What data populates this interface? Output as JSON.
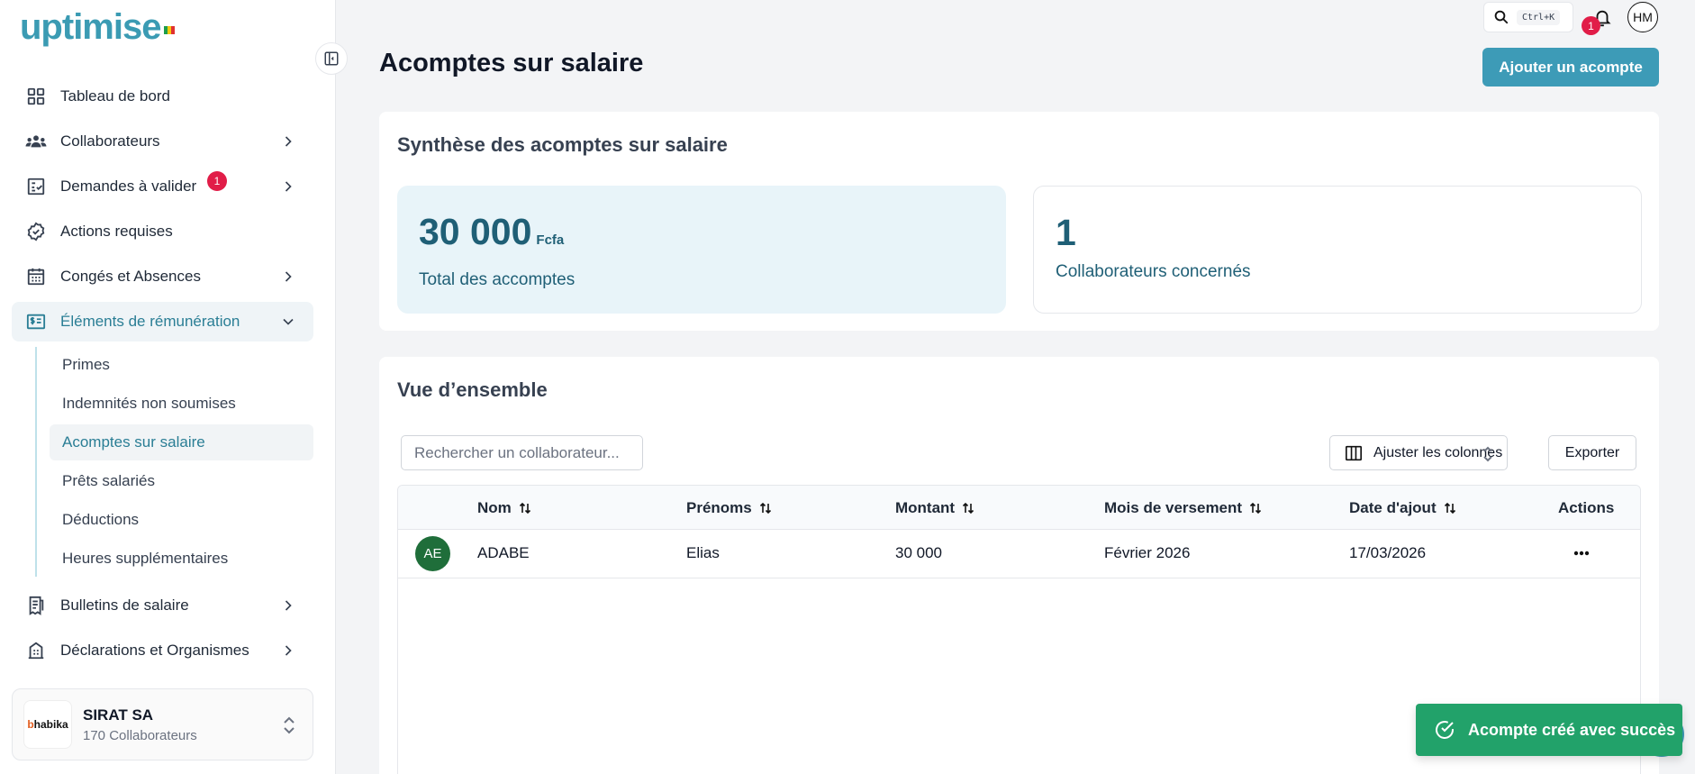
{
  "brand": {
    "logo_text": "uptimise",
    "accent": "#3d9bb7",
    "flag_colors": [
      "#1e9e4a",
      "#f6c90e",
      "#e03131"
    ]
  },
  "sidebar": {
    "items": [
      {
        "label": "Tableau de bord",
        "icon": "grid-icon"
      },
      {
        "label": "Collaborateurs",
        "icon": "users-icon",
        "has_chevron": true
      },
      {
        "label": "Demandes à valider",
        "icon": "checklist-icon",
        "has_chevron": true,
        "badge": "1"
      },
      {
        "label": "Actions requises",
        "icon": "badge-check-icon"
      },
      {
        "label": "Congés et Absences",
        "icon": "calendar-icon",
        "has_chevron": true
      },
      {
        "label": "Éléments de rémunération",
        "icon": "id-card-icon",
        "expanded": true
      }
    ],
    "submenu": [
      "Primes",
      "Indemnités non soumises",
      "Acomptes sur salaire",
      "Prêts salariés",
      "Déductions",
      "Heures supplémentaires"
    ],
    "active_sub": "Acomptes sur salaire",
    "items_after": [
      {
        "label": "Bulletins de salaire",
        "icon": "receipt-icon",
        "has_chevron": true
      },
      {
        "label": "Déclarations et Organismes",
        "icon": "building-icon",
        "has_chevron": true
      }
    ],
    "company": {
      "logo_text": "habika",
      "name": "SIRAT SA",
      "count": "170 Collaborateurs"
    }
  },
  "topbar": {
    "shortcut": "Ctrl+K",
    "notifications": "1",
    "user_initials": "HM"
  },
  "page": {
    "title": "Acomptes sur salaire",
    "add_label": "Ajouter un acompte"
  },
  "summary": {
    "title": "Synthèse des acomptes sur salaire",
    "total_value": "30 000",
    "total_unit": "Fcfa",
    "total_label": "Total des accomptes",
    "count_value": "1",
    "count_label": "Collaborateurs concernés"
  },
  "overview": {
    "title": "Vue d’ensemble",
    "search_placeholder": "Rechercher un collaborateur...",
    "columns_label": "Ajuster les colonnes",
    "export_label": "Exporter",
    "headers": [
      "Nom",
      "Prénoms",
      "Montant",
      "Mois de versement",
      "Date d'ajout",
      "Actions"
    ],
    "rows": [
      {
        "initials": "AE",
        "nom": "ADABE",
        "prenoms": "Elias",
        "montant": "30 000",
        "mois": "Février 2026",
        "date": "17/03/2026"
      }
    ]
  },
  "toast": {
    "message": "Acompte créé avec succès"
  }
}
